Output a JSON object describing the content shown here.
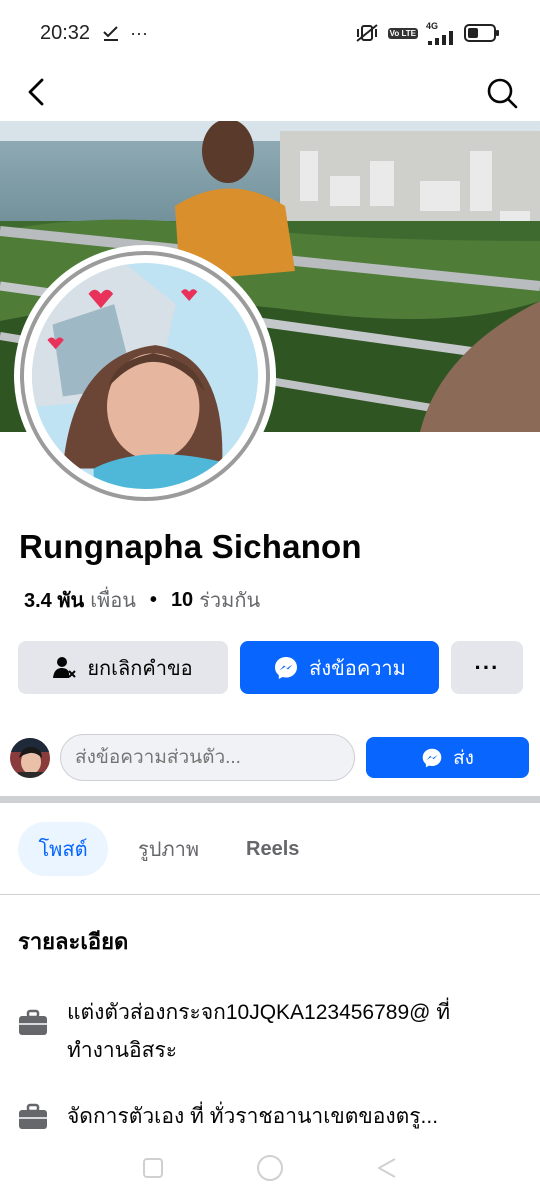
{
  "status_bar": {
    "time": "20:32",
    "left_icons": [
      "check-download-icon",
      "more-dots-icon"
    ],
    "more_dots": "···",
    "volte_badge": "Vo LTE",
    "network": "4G",
    "right_icons": [
      "mute-vibrate-icon",
      "volte-icon",
      "signal-icon",
      "battery-icon"
    ]
  },
  "nav": {
    "back_icon": "chevron-left-icon",
    "search_icon": "search-icon"
  },
  "profile": {
    "name": "Rungnapha Sichanon",
    "friends_count": "3.4 พัน",
    "friends_label": "เพื่อน",
    "separator": "•",
    "mutual_count": "10",
    "mutual_label": "ร่วมกัน"
  },
  "actions": {
    "cancel_request_label": "ยกเลิกคำขอ",
    "message_label": "ส่งข้อความ",
    "more_label": "···"
  },
  "composer": {
    "placeholder": "ส่งข้อความส่วนตัว...",
    "send_label": "ส่ง"
  },
  "tabs": [
    {
      "label": "โพสต์",
      "active": true
    },
    {
      "label": "รูปภาพ",
      "active": false
    },
    {
      "label": "Reels",
      "active": false
    }
  ],
  "details": {
    "heading": "รายละเอียด",
    "items": [
      {
        "icon": "briefcase-icon",
        "text": "แต่งตัวส่องกระจก10JQKA123456789@ ที่ ทำงานอิสระ"
      },
      {
        "icon": "briefcase-icon",
        "text": "จัดการตัวเอง ที่ ทั่วราชอานาเขตของตรู..."
      }
    ]
  },
  "colors": {
    "brand_blue": "#0866ff",
    "button_gray": "#e4e6eb",
    "secondary_text": "#65676b",
    "active_tab_bg": "#ebf5ff"
  }
}
